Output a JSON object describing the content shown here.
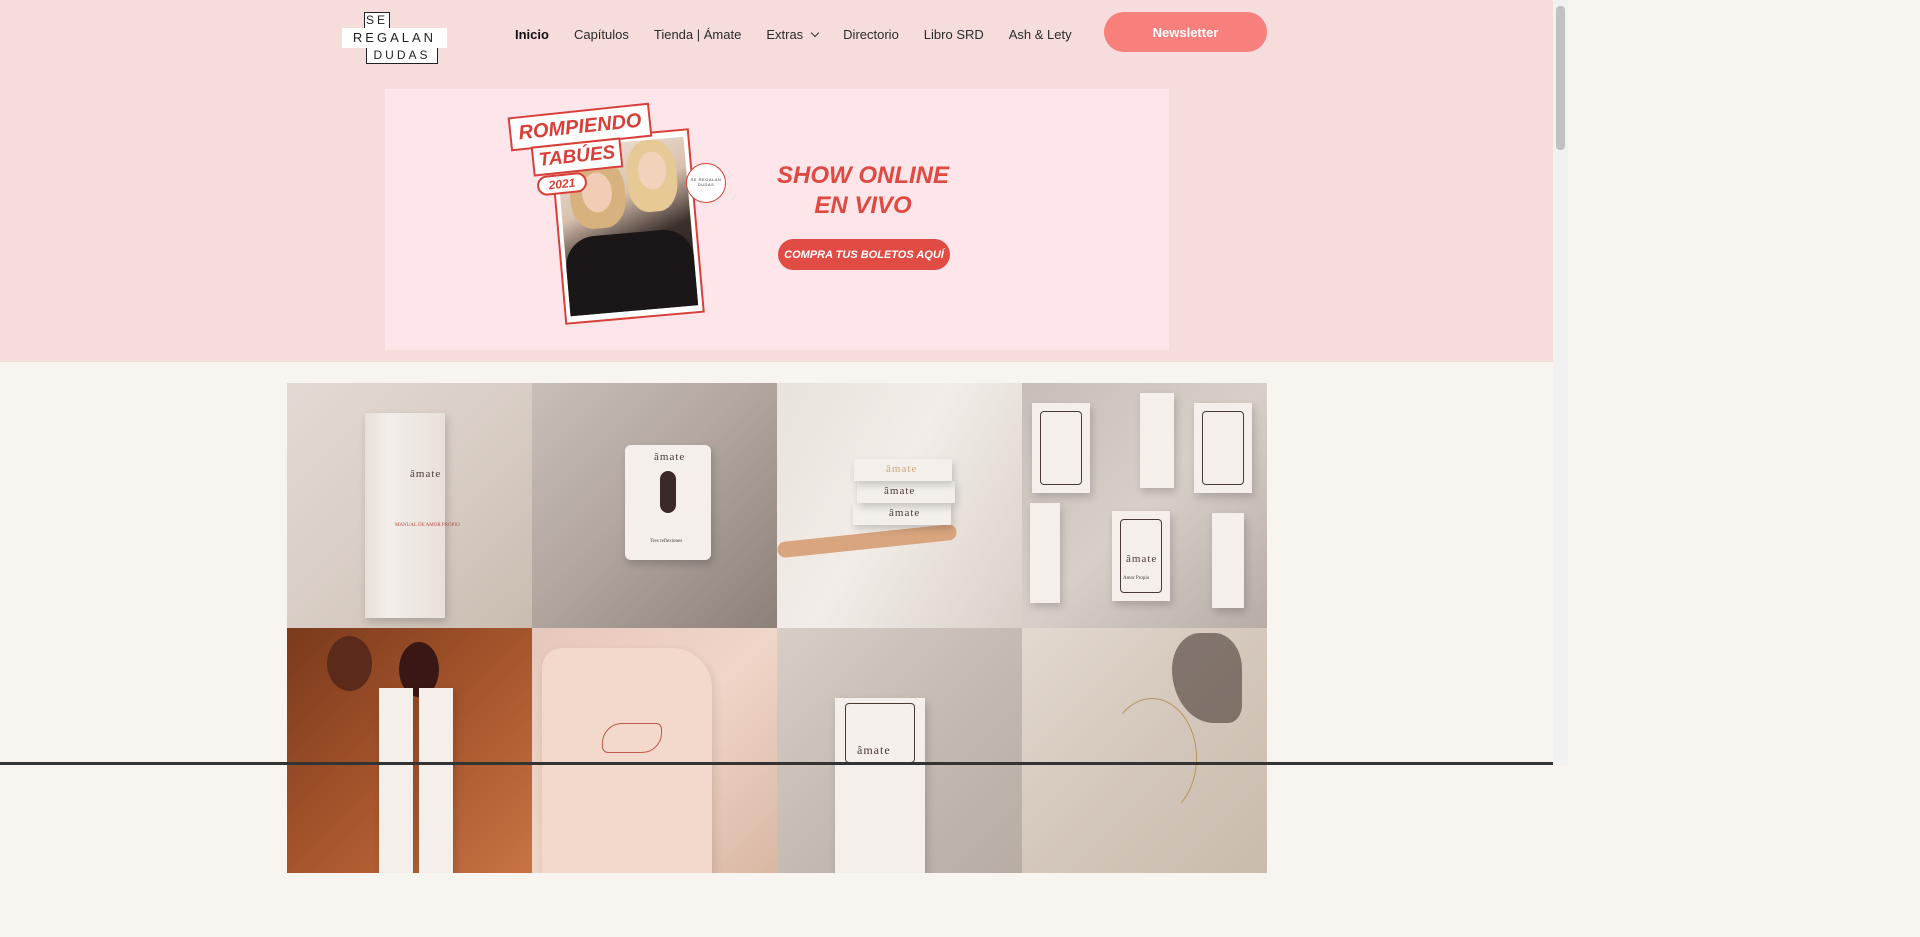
{
  "logo": {
    "line1": "SE",
    "line2": "REGALAN",
    "line3": "DUDAS"
  },
  "nav": {
    "items": [
      {
        "label": "Inicio"
      },
      {
        "label": "Capítulos"
      },
      {
        "label": "Tienda | Ámate"
      },
      {
        "label": "Extras"
      },
      {
        "label": "Directorio"
      },
      {
        "label": "Libro SRD"
      },
      {
        "label": "Ash & Lety"
      }
    ],
    "newsletter": "Newsletter"
  },
  "banner": {
    "tag1": "ROMPIENDO",
    "tag2": "TABÚES",
    "year": "2021",
    "seal": "SE REGALAN DUDAS",
    "show_line1": "SHOW ONLINE",
    "show_line2": "EN VIVO",
    "cta": "COMPRA TUS BOLETOS AQUÍ"
  },
  "products": {
    "brand": "âmate",
    "manual_label": "MANUAL DE AMOR PROPIO",
    "card_caption": "Tres reflexiones",
    "box_label": "Amor Propio"
  },
  "colors": {
    "header_bg": "#f6dcdb",
    "accent": "#f77f7c",
    "banner_red": "#de4a42"
  }
}
